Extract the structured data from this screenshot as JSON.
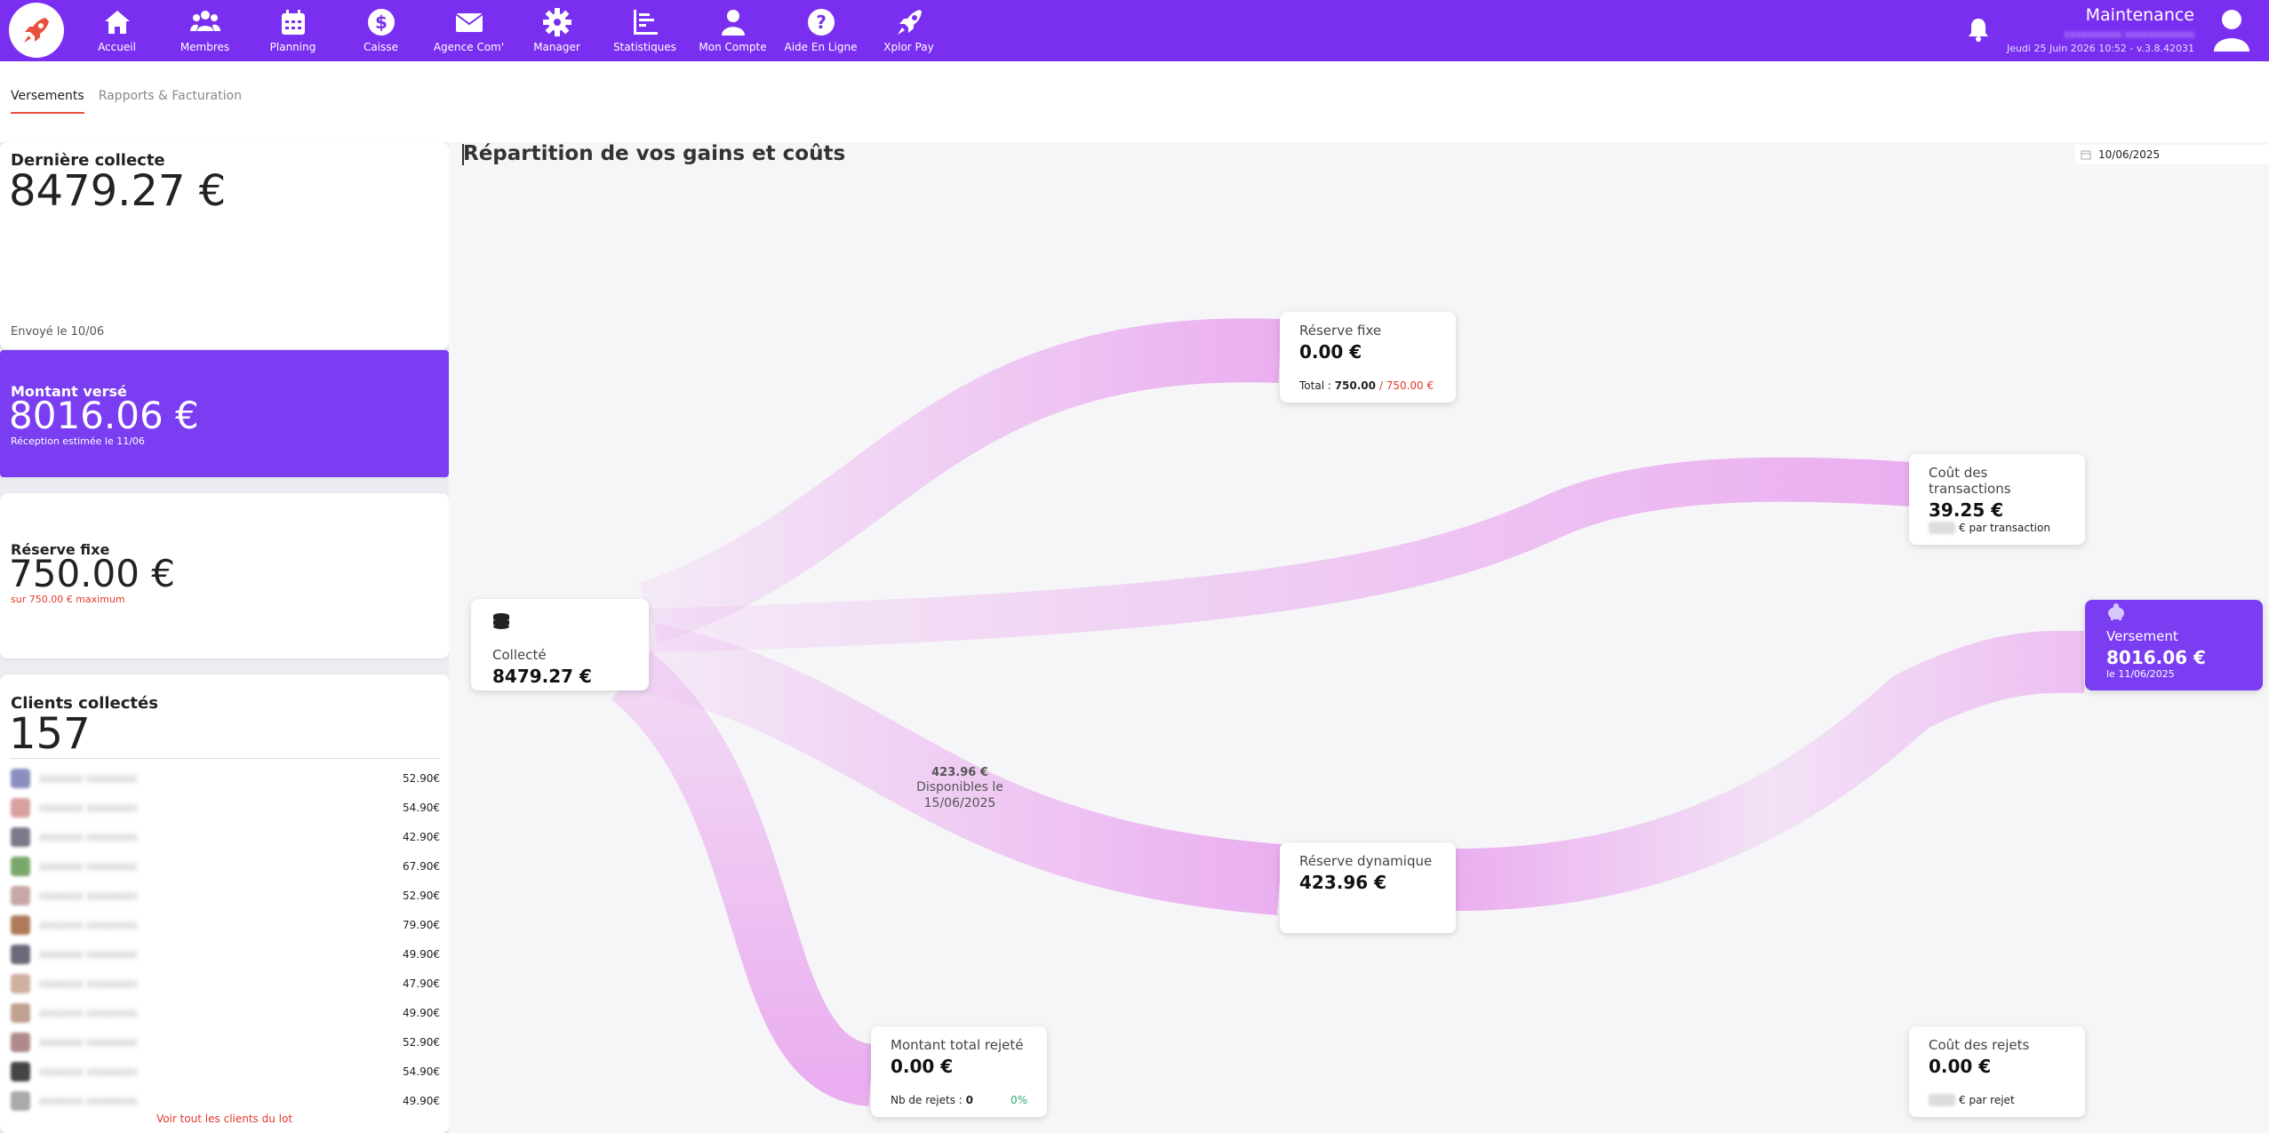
{
  "nav": {
    "items": [
      {
        "label": "Accueil",
        "icon": "home-icon"
      },
      {
        "label": "Membres",
        "icon": "members-icon"
      },
      {
        "label": "Planning",
        "icon": "calendar-icon"
      },
      {
        "label": "Caisse",
        "icon": "dollar-icon"
      },
      {
        "label": "Agence Com'",
        "icon": "mail-icon"
      },
      {
        "label": "Manager",
        "icon": "gear-icon"
      },
      {
        "label": "Statistiques",
        "icon": "chart-icon"
      },
      {
        "label": "Mon Compte",
        "icon": "user-icon"
      },
      {
        "label": "Aide En Ligne",
        "icon": "help-icon"
      },
      {
        "label": "Xplor Pay",
        "icon": "rocket-icon"
      }
    ],
    "user_role": "Maintenance",
    "date_version": "Jeudi 25 Juin 2026 10:52 - v.3.8.42031",
    "colors": {
      "bar": "#7a2ff0",
      "logo_icon": "#e94f3d"
    }
  },
  "tabs": [
    {
      "label": "Versements",
      "active": true
    },
    {
      "label": "Rapports & Facturation",
      "active": false
    }
  ],
  "left": {
    "derniere_collecte": {
      "title": "Dernière collecte",
      "amount": "8479.27 €",
      "note": "Envoyé le 10/06"
    },
    "montant_verse": {
      "title": "Montant versé",
      "amount": "8016.06 €",
      "note": "Réception estimée le 11/06"
    },
    "reserve_fixe": {
      "title": "Réserve fixe",
      "amount": "750.00 €",
      "note": "sur 750.00 € maximum"
    },
    "clients": {
      "title": "Clients collectés",
      "count": "157",
      "amounts": [
        "52.90€",
        "54.90€",
        "42.90€",
        "67.90€",
        "52.90€",
        "79.90€",
        "49.90€",
        "47.90€",
        "49.90€",
        "52.90€",
        "54.90€",
        "49.90€"
      ],
      "see_all": "Voir tout les clients du lot"
    }
  },
  "main": {
    "title": "Répartition de vos gains et coûts",
    "date": "10/06/2025",
    "nodes": {
      "collecte": {
        "label": "Collecté",
        "value": "8479.27 €",
        "icon": "coins-icon"
      },
      "reserve_fixe": {
        "label": "Réserve fixe",
        "value": "0.00 €",
        "foot_prefix": "Total : ",
        "foot_total": "750.00",
        "foot_max": " / 750.00 €"
      },
      "cout_transactions": {
        "label": "Coût des transactions",
        "value": "39.25 €",
        "foot": "€ par transaction"
      },
      "versement": {
        "label": "Versement",
        "value": "8016.06 €",
        "foot": "le 11/06/2025",
        "icon": "piggy-bank-icon"
      },
      "reserve_dynamique": {
        "label": "Réserve dynamique",
        "value": "423.96 €"
      },
      "rejete": {
        "label": "Montant total rejeté",
        "value": "0.00 €",
        "foot_prefix": "Nb de rejets : ",
        "foot_count": "0",
        "foot_pct": "0%"
      },
      "cout_rejets": {
        "label": "Coût des rejets",
        "value": "0.00 €",
        "foot": "€ par rejet"
      }
    },
    "flow_annotation": {
      "amount": "423.96 €",
      "line1": "Disponibles le",
      "line2": "15/06/2025"
    },
    "flow_color": "#e9a6ef"
  }
}
